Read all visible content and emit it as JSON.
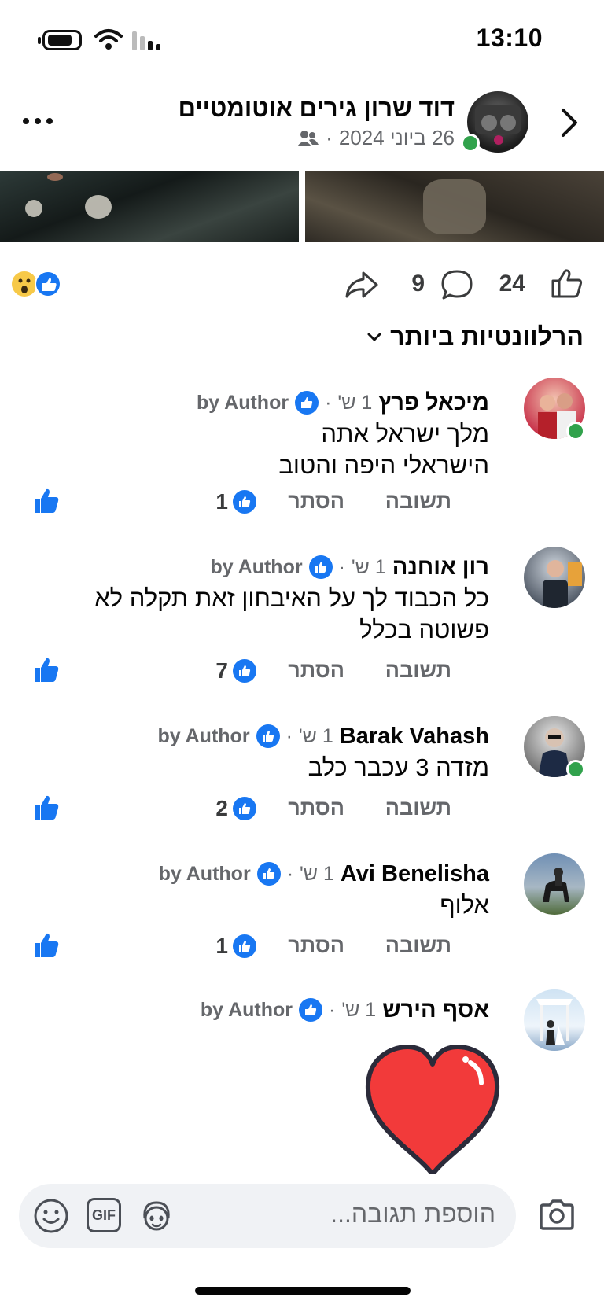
{
  "status_bar": {
    "time": "13:10",
    "icons": [
      "battery-icon",
      "wifi-icon",
      "cellular-signal-icon"
    ]
  },
  "post": {
    "page_name": "דוד שרון גירים אוטומטיים",
    "date": "26 ביוני 2024",
    "separator": "·",
    "audience_icon": "friends-icon"
  },
  "actions": {
    "like_count": "24",
    "comment_count": "9",
    "reactions": [
      "wow-reaction-icon",
      "like-reaction-icon"
    ]
  },
  "sort": {
    "label": "הרלוונטיות ביותר"
  },
  "comments": [
    {
      "name": "מיכאל פרץ",
      "age": "1 ש'",
      "author_label": "by Author",
      "text_lines": [
        "מלך ישראל אתה",
        "הישראלי היפה והטוב"
      ],
      "reply": "תשובה",
      "hide": "הסתר",
      "likes": "1",
      "online": true
    },
    {
      "name": "רון אוחנה",
      "age": "1 ש'",
      "author_label": "by Author",
      "text_lines": [
        "כל הכבוד לך על האיבחון זאת תקלה לא",
        "פשוטה בכלל"
      ],
      "reply": "תשובה",
      "hide": "הסתר",
      "likes": "7",
      "online": false
    },
    {
      "name": "Barak Vahash",
      "age": "1 ש'",
      "author_label": "by Author",
      "text_lines": [
        "מזדה 3 עכבר כלב"
      ],
      "reply": "תשובה",
      "hide": "הסתר",
      "likes": "2",
      "online": true
    },
    {
      "name": "Avi Benelisha",
      "age": "1 ש'",
      "author_label": "by Author",
      "text_lines": [
        "אלוף"
      ],
      "reply": "תשובה",
      "hide": "הסתר",
      "likes": "1",
      "online": false
    },
    {
      "name": "אסף הירש",
      "age": "1 ש'",
      "author_label": "by Author",
      "sticker": "heart-sticker"
    }
  ],
  "composer": {
    "placeholder": "הוספת תגובה...",
    "gif_label": "GIF"
  },
  "colors": {
    "accent": "#1877f2",
    "online": "#31a24c",
    "secondary_text": "#65676b",
    "heart": "#f23a3a"
  }
}
